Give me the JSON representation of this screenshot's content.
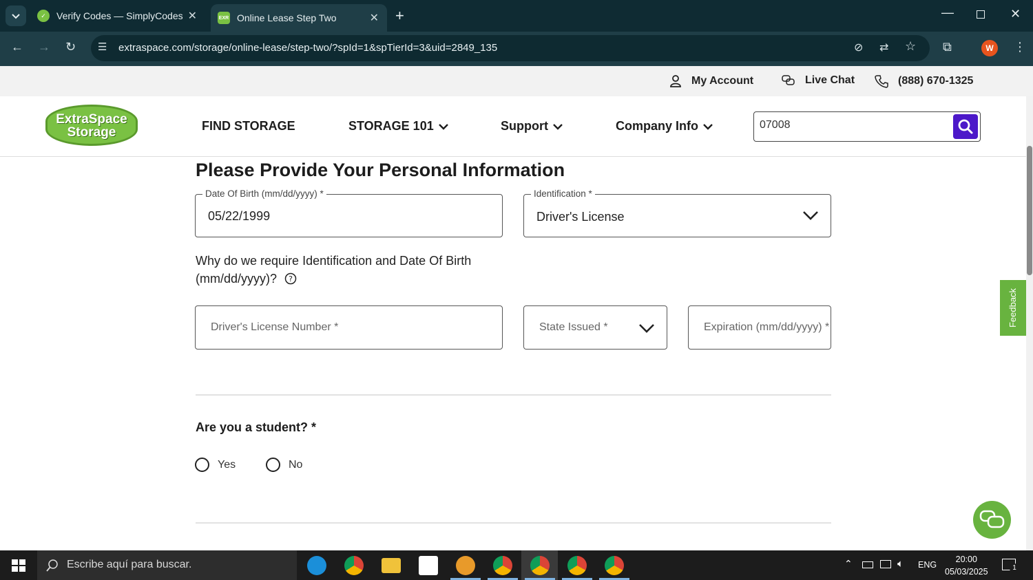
{
  "browser": {
    "tabs": [
      {
        "title": "Verify Codes — SimplyCodes",
        "active": false
      },
      {
        "title": "Online Lease Step Two",
        "active": true
      }
    ],
    "favicon_active_text": "EXR",
    "url": "extraspace.com/storage/online-lease/step-two/?spId=1&spTierId=3&uid=2849_135",
    "profile_initial": "W"
  },
  "utility_bar": {
    "account": "My Account",
    "chat": "Live Chat",
    "phone": "(888) 670-1325"
  },
  "header": {
    "logo_line1": "ExtraSpace",
    "logo_line2": "Storage",
    "nav": [
      "FIND STORAGE",
      "STORAGE 101",
      "Support",
      "Company Info"
    ],
    "search_value": "07008"
  },
  "form": {
    "heading": "Please Provide Your Personal Information",
    "dob_label": "Date Of Birth (mm/dd/yyyy) *",
    "dob_value": "05/22/1999",
    "id_label": "Identification *",
    "id_value": "Driver's License",
    "why_text": "Why do we require Identification and Date Of Birth (mm/dd/yyyy)?",
    "license_placeholder": "Driver's License Number *",
    "state_placeholder": "State Issued *",
    "expiration_placeholder": "Expiration (mm/dd/yyyy) *",
    "student_question": "Are you a student? *",
    "student_options": [
      "Yes",
      "No"
    ]
  },
  "feedback_label": "Feedback",
  "taskbar": {
    "search_placeholder": "Escribe aquí para buscar.",
    "lang": "ENG",
    "time": "20:00",
    "date": "05/03/2025",
    "notification_count": "1"
  },
  "colors": {
    "brand_green": "#7ac143",
    "search_purple": "#4c18c9",
    "browser_dark": "#0f2b33"
  }
}
